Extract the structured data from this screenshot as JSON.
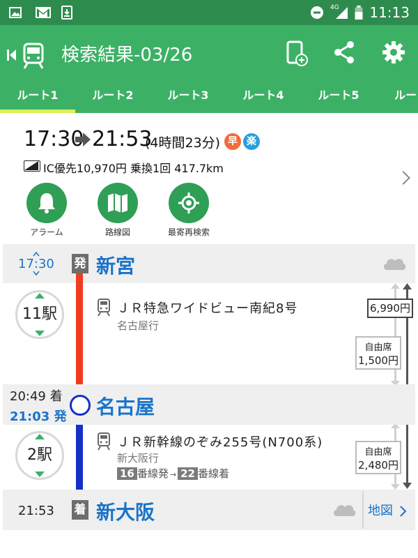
{
  "status_bar": {
    "time": "11:13",
    "network": "4G"
  },
  "app_bar": {
    "title": "検索結果-03/26"
  },
  "tabs": [
    {
      "label": "ルート1",
      "active": true
    },
    {
      "label": "ルート2"
    },
    {
      "label": "ルート3"
    },
    {
      "label": "ルート4"
    },
    {
      "label": "ルート5"
    },
    {
      "label": "ルー"
    }
  ],
  "summary": {
    "depart": "17:30",
    "arrive": "21:53",
    "duration": "(4時間23分)",
    "badge_fast": "早",
    "badge_easy": "楽",
    "info": "IC優先10,970円 乗換1回 417.7km"
  },
  "actions": [
    {
      "label": "アラーム",
      "icon": "bell-icon"
    },
    {
      "label": "路線図",
      "icon": "map-icon"
    },
    {
      "label": "最寄再検索",
      "icon": "locate-icon"
    }
  ],
  "route": {
    "origin": {
      "time": "17:30",
      "kind": "発",
      "name": "新宮"
    },
    "leg1": {
      "stops": "11駅",
      "train": "ＪＲ特急ワイドビュー南紀8号",
      "dest": "名古屋行",
      "fare_label": "自由席",
      "fare": "1,500円",
      "total_fare": "6,990円",
      "line_color": "#f03c1e"
    },
    "transfer": {
      "arr_time": "20:49 着",
      "dep_time": "21:03 発",
      "name": "名古屋"
    },
    "leg2": {
      "stops": "2駅",
      "train": "ＪＲ新幹線のぞみ255号(N700系)",
      "dest": "新大阪行",
      "dep_track": "16",
      "dep_track_label": "番線発",
      "arr_track": "22",
      "arr_track_label": "番線着",
      "fare_label": "自由席",
      "fare": "2,480円",
      "line_color": "#1430c8"
    },
    "destination": {
      "time": "21:53",
      "kind": "着",
      "name": "新大阪",
      "map_label": "地図"
    }
  },
  "colors": {
    "primary": "#3cb166",
    "status": "#2e8b4e",
    "accent_blue": "#1a73c8"
  }
}
